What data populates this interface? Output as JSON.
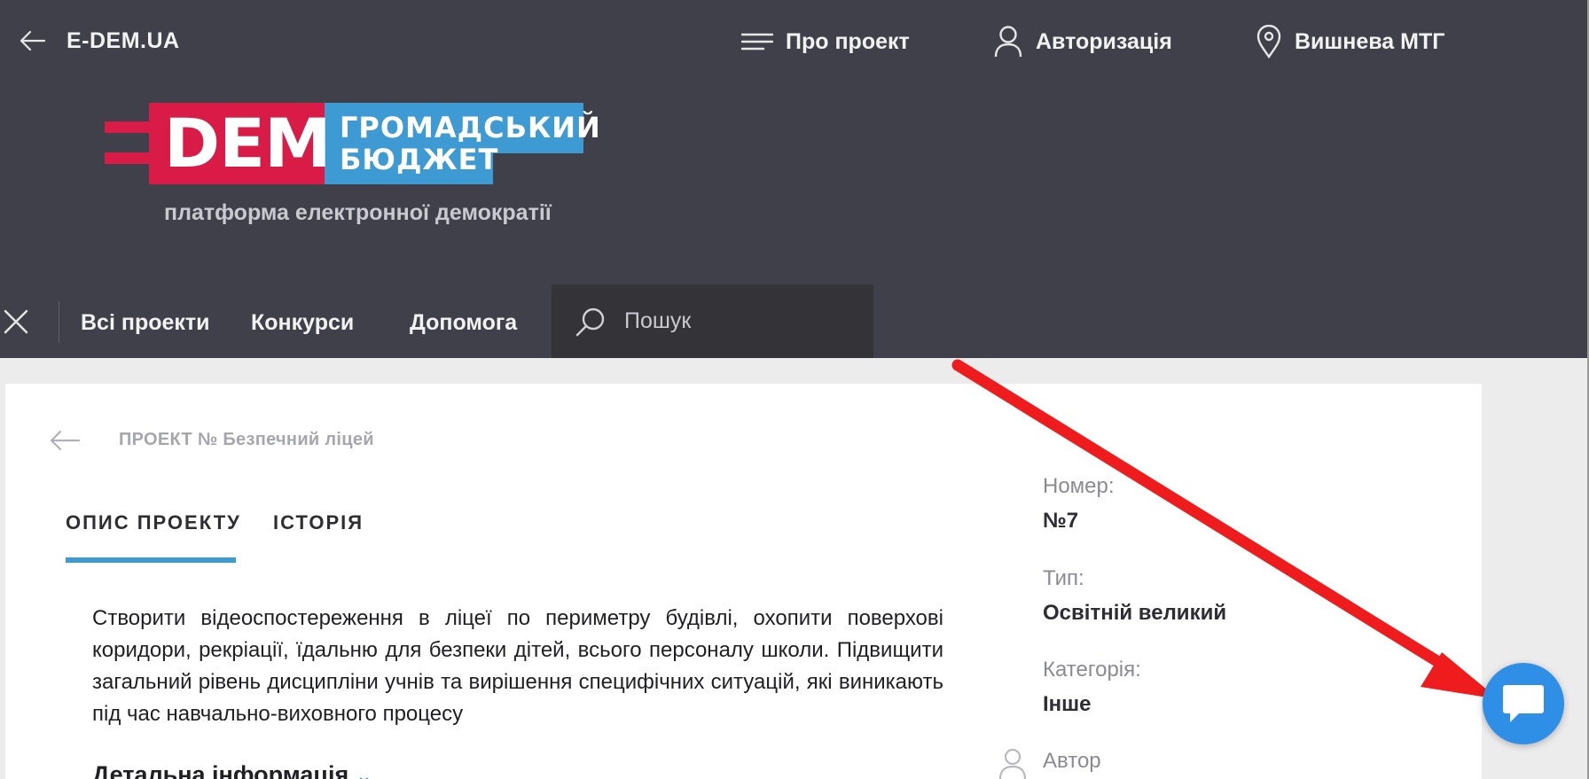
{
  "topbar": {
    "site_name": "E-DEM.UA",
    "about_label": "Про проект",
    "login_label": "Авторизація",
    "location_label": "Вишнева МТГ"
  },
  "logo": {
    "dem": "DEM",
    "line1": "ГРОМАДСЬКИЙ",
    "line2": "БЮДЖЕТ",
    "tagline": "платформа електронної демократії"
  },
  "nav": {
    "items": [
      "Всі проекти",
      "Конкурси",
      "Допомога"
    ],
    "search_placeholder": "Пошук"
  },
  "project": {
    "breadcrumb": "ПРОЕКТ № Безпечний ліцей",
    "tabs": [
      "ОПИС ПРОЕКТУ",
      "ІСТОРІЯ"
    ],
    "description": "Створити відеоспостереження в ліцеї по периметру будівлі, охопити поверхові коридори, рекріації, їдальню для безпеки дітей, всього персоналу школи. Підвищити загальний рівень дисципліни учнів та вирішення специфічних ситуацій, які виникають під час навчально-виховного процесу",
    "detail_label": "Детальна інформація"
  },
  "meta": {
    "number_label": "Номер:",
    "number_value": "№7",
    "type_label": "Тип:",
    "type_value": "Освітній великий",
    "category_label": "Категорія:",
    "category_value": "Інше",
    "author_label": "Автор"
  },
  "colors": {
    "header_bg": "#40404a",
    "brand_red": "#d81b47",
    "brand_blue": "#3d9ad2",
    "chat_blue": "#2f8fe6",
    "annotation_red": "#ee1c1c"
  }
}
